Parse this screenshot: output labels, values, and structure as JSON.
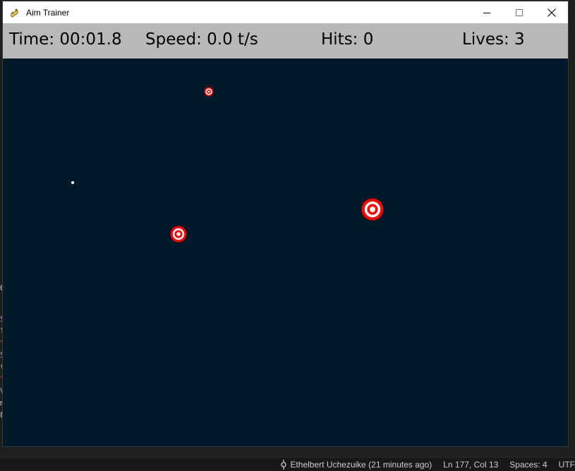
{
  "window": {
    "title": "Aim Trainer",
    "icon": "pygame-snake-icon",
    "controls": [
      "minimize-icon",
      "maximize-icon",
      "close-icon"
    ]
  },
  "hud": {
    "time": "Time: 00:01.8",
    "speed": "Speed: 0.0 t/s",
    "hits": "Hits: 0",
    "lives": "Lives: 3"
  },
  "game": {
    "background_color": "#001a29",
    "hud_color": "#b8b8b8",
    "target_colors": [
      "#ff0000",
      "#ffffff"
    ]
  },
  "background_editor": {
    "left_fragments": [
      "0",
      "S",
      "l",
      "^",
      "S",
      "t",
      "^",
      "V",
      "m",
      "8"
    ],
    "status_bar": {
      "git_blame": "Ethelbert Uchezuike (21 minutes ago)",
      "cursor": "Ln 177, Col 13",
      "indent": "Spaces: 4",
      "encoding": "UTF"
    }
  }
}
